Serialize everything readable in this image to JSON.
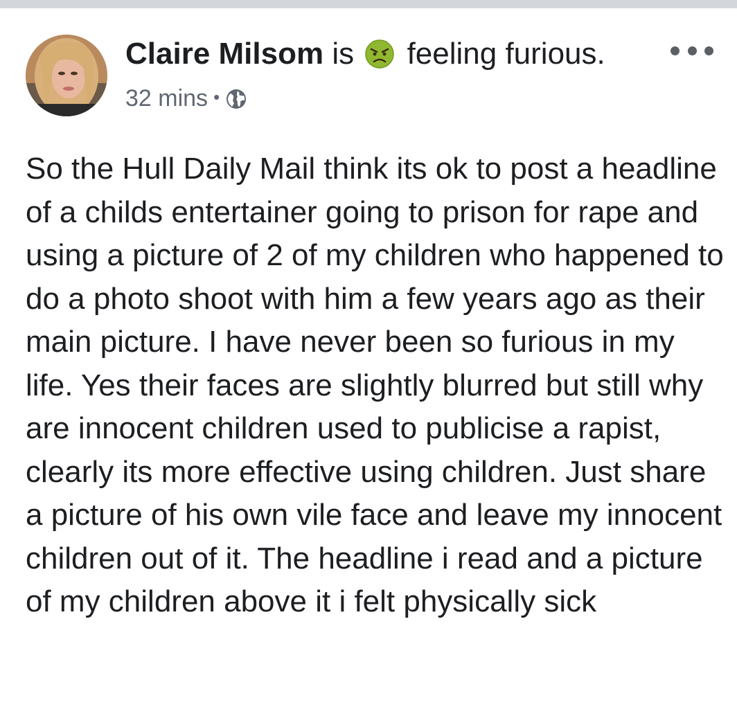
{
  "post": {
    "author": "Claire Milsom",
    "status_prefix": "is",
    "feeling_icon": "angry-face-emoji",
    "feeling_text": "feeling furious.",
    "timestamp": "32 mins",
    "separator": "•",
    "privacy_icon": "globe-icon",
    "more_icon": "more-options-icon",
    "body": "So the Hull Daily Mail think its ok to post a headline of a childs entertainer going to prison for rape and using a picture of 2 of my children who happened to do a photo shoot with him a few years ago as their main picture. I have never been so furious in my life. Yes their faces are slightly blurred but still why are innocent children used to publicise a rapist, clearly its more effective using children. Just share a picture of his own vile face and leave my innocent children out of it. The headline i read and a picture of my children above it i felt physically sick"
  },
  "colors": {
    "text_primary": "#1c1e21",
    "text_secondary": "#606770",
    "top_strip": "#d3d6db",
    "emoji_face": "#8fb830"
  }
}
